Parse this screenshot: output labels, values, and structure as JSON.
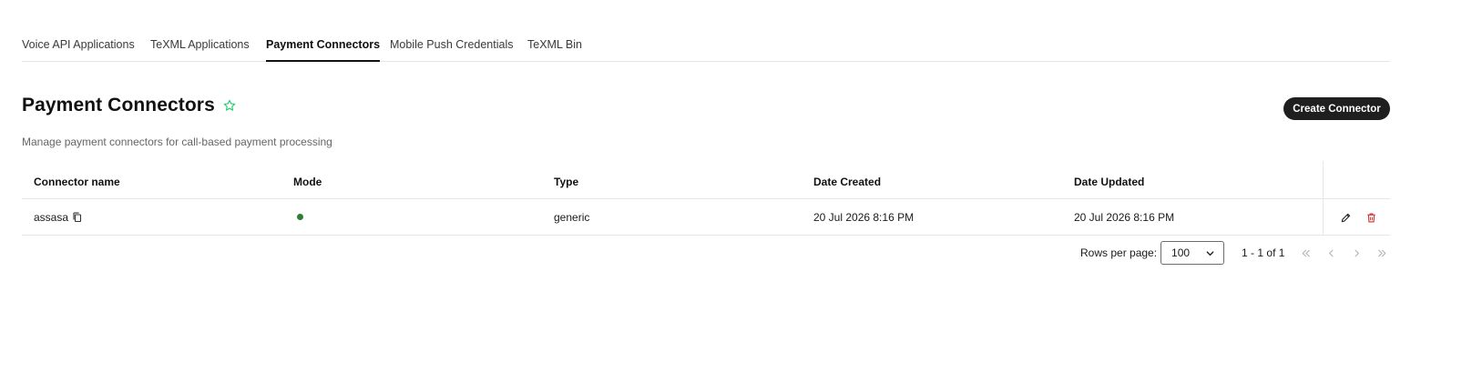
{
  "tabs": [
    {
      "label": "Voice API Applications",
      "active": false
    },
    {
      "label": "TeXML Applications",
      "active": false
    },
    {
      "label": "Payment Connectors",
      "active": true
    },
    {
      "label": "Mobile Push Credentials",
      "active": false
    },
    {
      "label": "TeXML Bin",
      "active": false
    }
  ],
  "header": {
    "title": "Payment Connectors",
    "subtitle": "Manage payment connectors for call-based payment processing",
    "create_button": "Create Connector",
    "favorite_icon": "star-outline-icon"
  },
  "table": {
    "columns": [
      "Connector name",
      "Mode",
      "Type",
      "Date Created",
      "Date Updated"
    ],
    "rows": [
      {
        "name": "assasa",
        "mode_status": "active",
        "type": "generic",
        "date_created": "20 Jul 2026 8:16 PM",
        "date_updated": "20 Jul 2026 8:16 PM"
      }
    ]
  },
  "pagination": {
    "rows_per_page_label": "Rows per page:",
    "rows_per_page_value": "100",
    "range": "1 - 1 of 1"
  },
  "colors": {
    "accent_green": "#2ecc71",
    "status_green": "#2e7d32",
    "delete_red": "#d32f2f",
    "button_dark": "#1f1f1f"
  }
}
